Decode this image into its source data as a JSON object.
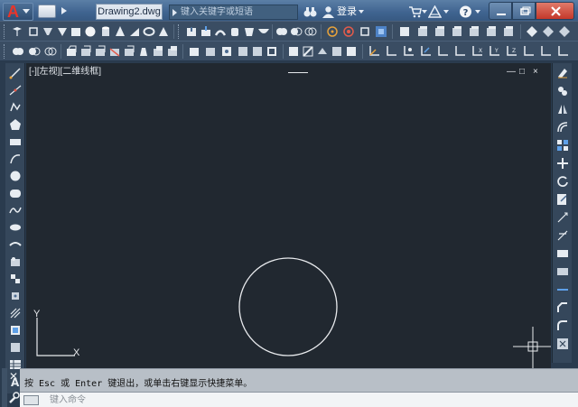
{
  "window": {
    "doc_title": "Drawing2.dwg",
    "search_placeholder": "键入关键字或短语",
    "login_label": "登录",
    "app_logo_letter": "A"
  },
  "viewport": {
    "label": "[-][左视][二维线框]",
    "controls": [
      "—",
      "□",
      "×"
    ],
    "ucs_x": "X",
    "ucs_y": "Y"
  },
  "command": {
    "history": "按 Esc 或 Enter 键退出，或单击右键显示快捷菜单。",
    "placeholder": "键入命令",
    "close_glyph": "✕"
  },
  "colors": {
    "canvas_bg": "#212830",
    "toolbar_bg": "#3a4d63",
    "titlebar": "#3f6490",
    "accent_red": "#e8352a",
    "drawing_line": "#e8eaed"
  }
}
